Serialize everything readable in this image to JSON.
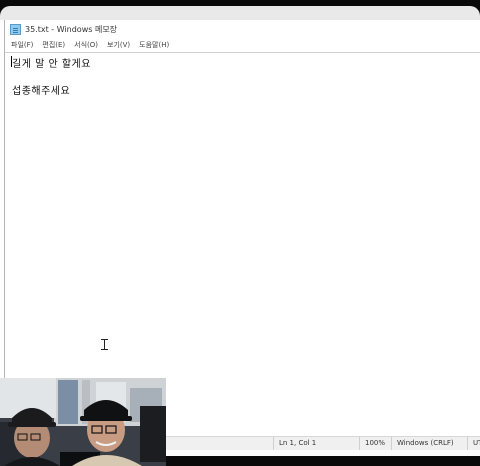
{
  "window": {
    "title": "35.txt - Windows 메모장"
  },
  "menu": [
    "파일(F)",
    "편집(E)",
    "서식(O)",
    "보기(V)",
    "도움말(H)"
  ],
  "editor": {
    "lines": [
      "길게 말 안 할게요",
      "섭종해주세요"
    ]
  },
  "status": {
    "position": "Ln 1, Col 1",
    "zoom": "100%",
    "line_ending": "Windows (CRLF)",
    "encoding": "UT"
  },
  "colors": {
    "background": "#ffffff",
    "statusbar": "#f0f0f0",
    "bezel": "#0a0a0a"
  }
}
